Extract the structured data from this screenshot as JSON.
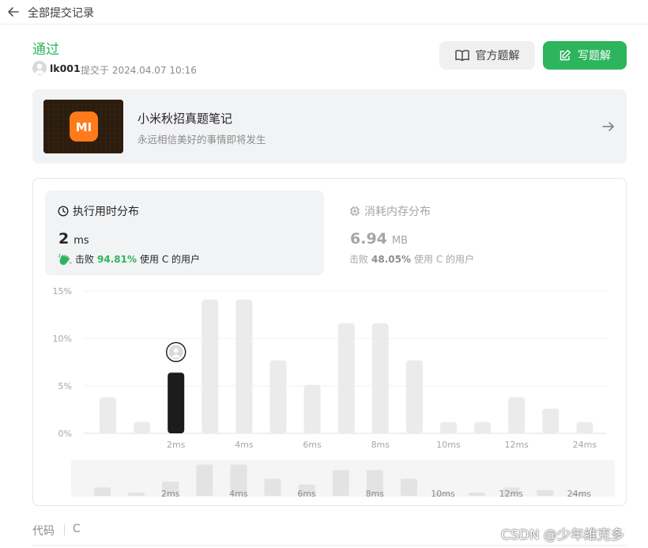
{
  "topbar": {
    "back_label": "全部提交记录"
  },
  "submission": {
    "status": "通过",
    "user": "lk001",
    "submitted_text": "提交于 2024.04.07 10:16"
  },
  "buttons": {
    "official_solution": "官方题解",
    "write_solution": "写题解"
  },
  "promo": {
    "title": "小米秋招真题笔记",
    "subtitle": "永远相信美好的事情即将发生",
    "thumb_text": "MI"
  },
  "runtime": {
    "title": "执行用时分布",
    "value": "2",
    "unit": "ms",
    "beat_prefix": "击败",
    "beat_pct": "94.81%",
    "beat_suffix": "使用 C 的用户"
  },
  "memory": {
    "title": "消耗内存分布",
    "value": "6.94",
    "unit": "MB",
    "beat_prefix": "击败",
    "beat_pct": "48.05%",
    "beat_suffix": "使用 C 的用户"
  },
  "chart_data": {
    "type": "bar",
    "ytick_labels": [
      "0%",
      "5%",
      "10%",
      "15%"
    ],
    "ylim": [
      0,
      15
    ],
    "xtick_labels": [
      "2ms",
      "4ms",
      "6ms",
      "8ms",
      "10ms",
      "12ms",
      "24ms"
    ],
    "values": [
      3.8,
      1.2,
      6.4,
      14.1,
      14.1,
      7.7,
      5.1,
      11.6,
      11.6,
      7.7,
      1.2,
      1.2,
      3.8,
      2.6,
      1.2
    ],
    "highlight_index": 2,
    "grid": true
  },
  "code": {
    "label": "代码",
    "lang": "C"
  },
  "watermark": "CSDN @少年维克多",
  "colors": {
    "accent": "#2db55d",
    "bar": "#ebebeb",
    "highlight": "#1c1c1c"
  }
}
